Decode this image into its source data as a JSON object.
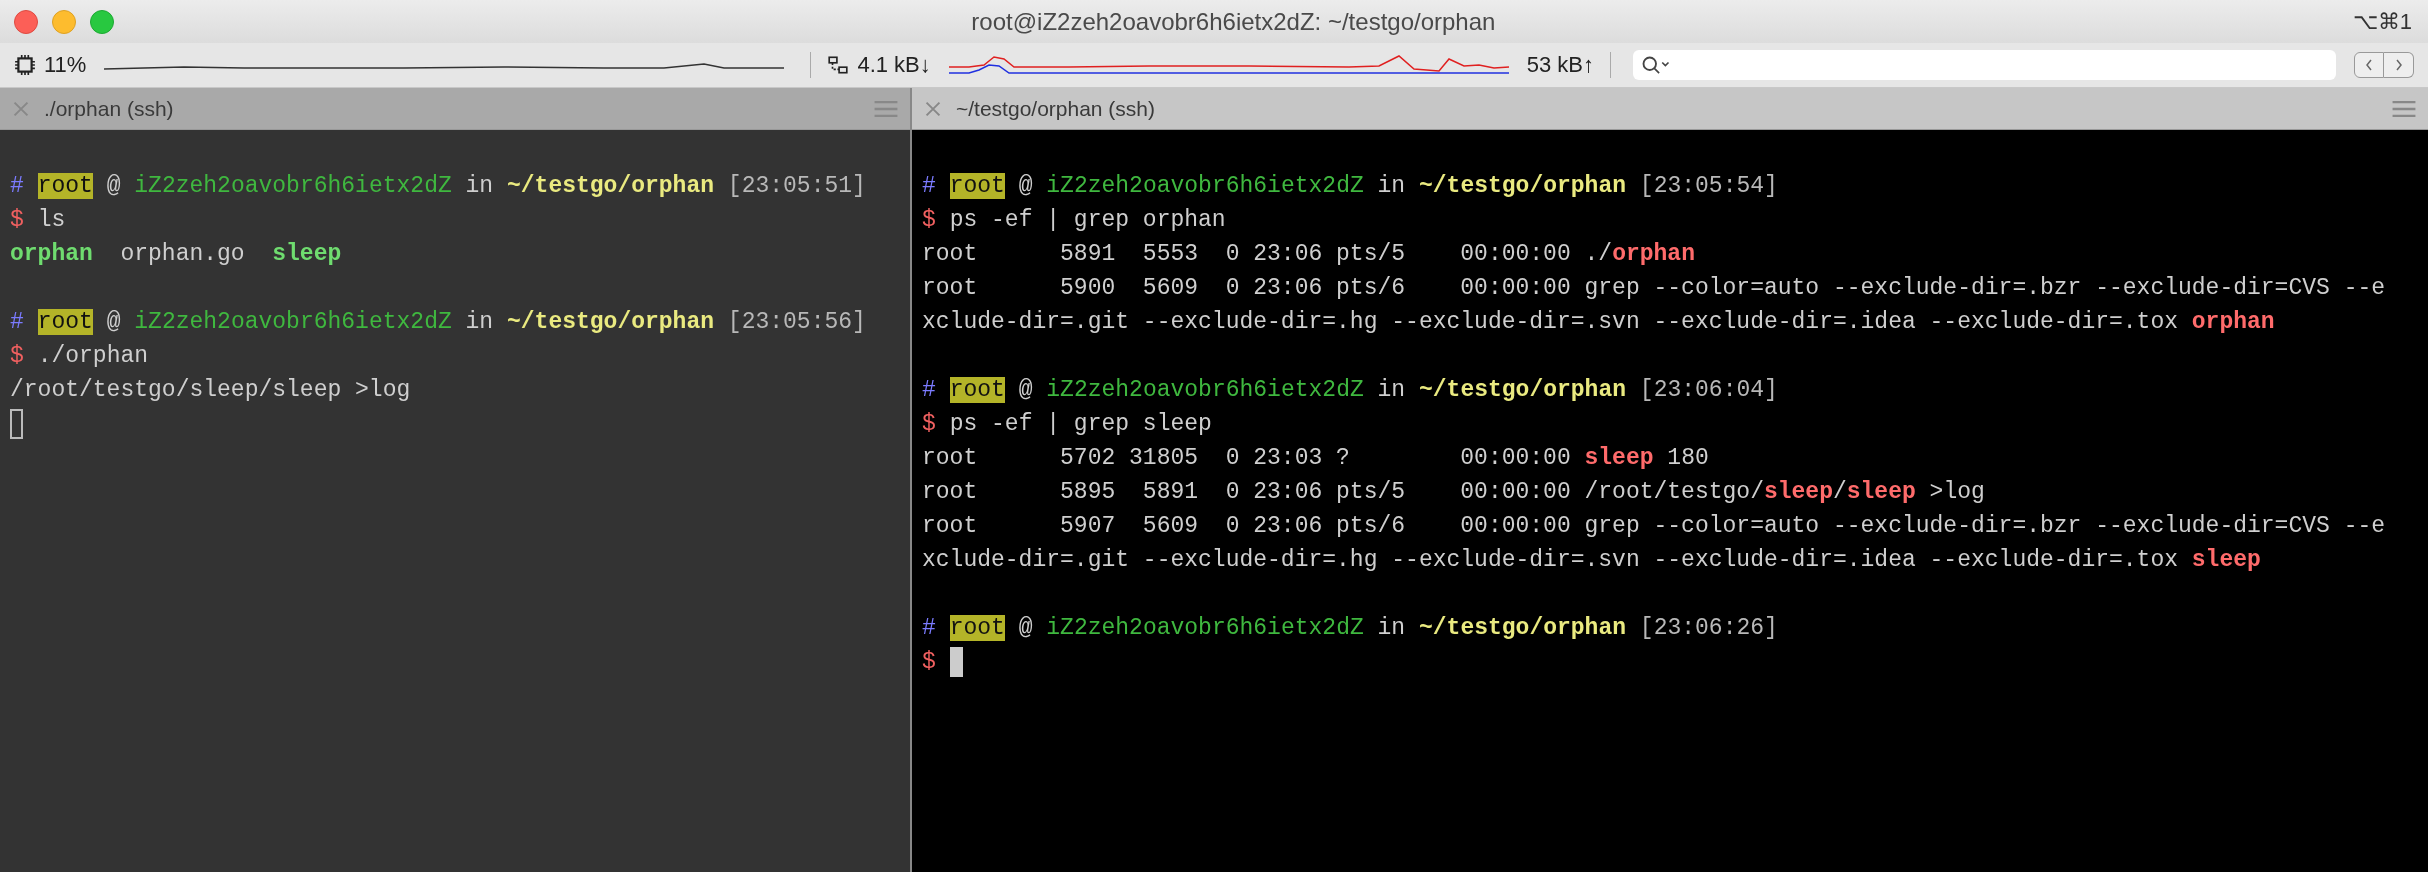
{
  "window": {
    "title": "root@iZ2zeh2oavobr6h6ietx2dZ: ~/testgo/orphan",
    "shortcut": "⌥⌘1"
  },
  "status_bar": {
    "cpu": "11%",
    "download": "4.1 kB↓",
    "upload": "53 kB↑"
  },
  "panes": [
    {
      "tab": "./orphan (ssh)",
      "selected": false,
      "blocks": [
        {
          "lines": [
            {
              "kind": "prompt",
              "hash": "#",
              "user": "root",
              "at": "@",
              "host": "iZ2zeh2oavobr6h6ietx2dZ",
              "in": "in",
              "path": "~/testgo/orphan",
              "time": "[23:05:51]"
            },
            {
              "kind": "command",
              "prompt": "$",
              "command": "ls"
            },
            {
              "kind": "output",
              "segments": [
                {
                  "text": "orphan",
                  "kind": "dir"
                },
                {
                  "text": "  orphan.go  "
                },
                {
                  "text": "sleep",
                  "kind": "dir"
                }
              ]
            }
          ]
        },
        {
          "lines": [
            {
              "kind": "prompt",
              "hash": "#",
              "user": "root",
              "at": "@",
              "host": "iZ2zeh2oavobr6h6ietx2dZ",
              "in": "in",
              "path": "~/testgo/orphan",
              "time": "[23:05:56]"
            },
            {
              "kind": "command",
              "prompt": "$",
              "command": "./orphan"
            },
            {
              "kind": "output",
              "segments": [
                {
                  "text": "/root/testgo/sleep/sleep >log"
                }
              ]
            },
            {
              "kind": "output",
              "cursor": true
            }
          ]
        }
      ]
    },
    {
      "tab": "~/testgo/orphan (ssh)",
      "selected": true,
      "blocks": [
        {
          "lines": [
            {
              "kind": "prompt",
              "hash": "#",
              "user": "root",
              "at": "@",
              "host": "iZ2zeh2oavobr6h6ietx2dZ",
              "in": "in",
              "path": "~/testgo/orphan",
              "time": "[23:05:54]"
            },
            {
              "kind": "command",
              "prompt": "$",
              "command": "ps -ef | grep orphan"
            },
            {
              "kind": "output",
              "segments": [
                {
                  "text": "root      5891  5553  0 23:06 pts/5    00:00:00 ./"
                },
                {
                  "text": "orphan",
                  "kind": "match"
                }
              ]
            },
            {
              "kind": "output",
              "segments": [
                {
                  "text": "root      5900  5609  0 23:06 pts/6    00:00:00 grep --color=auto --exclude-dir=.bzr --exclude-dir=CVS --e"
                }
              ]
            },
            {
              "kind": "output",
              "segments": [
                {
                  "text": "xclude-dir=.git --exclude-dir=.hg --exclude-dir=.svn --exclude-dir=.idea --exclude-dir=.tox "
                },
                {
                  "text": "orphan",
                  "kind": "match"
                }
              ]
            }
          ]
        },
        {
          "lines": [
            {
              "kind": "prompt",
              "hash": "#",
              "user": "root",
              "at": "@",
              "host": "iZ2zeh2oavobr6h6ietx2dZ",
              "in": "in",
              "path": "~/testgo/orphan",
              "time": "[23:06:04]"
            },
            {
              "kind": "command",
              "prompt": "$",
              "command": "ps -ef | grep sleep"
            },
            {
              "kind": "output",
              "segments": [
                {
                  "text": "root      5702 31805  0 23:03 ?        00:00:00 "
                },
                {
                  "text": "sleep",
                  "kind": "match"
                },
                {
                  "text": " 180"
                }
              ]
            },
            {
              "kind": "output",
              "segments": [
                {
                  "text": "root      5895  5891  0 23:06 pts/5    00:00:00 /root/testgo/"
                },
                {
                  "text": "sleep",
                  "kind": "match"
                },
                {
                  "text": "/"
                },
                {
                  "text": "sleep",
                  "kind": "match"
                },
                {
                  "text": " >log"
                }
              ]
            },
            {
              "kind": "output",
              "segments": [
                {
                  "text": "root      5907  5609  0 23:06 pts/6    00:00:00 grep --color=auto --exclude-dir=.bzr --exclude-dir=CVS --e"
                }
              ]
            },
            {
              "kind": "output",
              "segments": [
                {
                  "text": "xclude-dir=.git --exclude-dir=.hg --exclude-dir=.svn --exclude-dir=.idea --exclude-dir=.tox "
                },
                {
                  "text": "sleep",
                  "kind": "match"
                }
              ]
            }
          ]
        },
        {
          "lines": [
            {
              "kind": "prompt",
              "hash": "#",
              "user": "root",
              "at": "@",
              "host": "iZ2zeh2oavobr6h6ietx2dZ",
              "in": "in",
              "path": "~/testgo/orphan",
              "time": "[23:06:26]"
            },
            {
              "kind": "command",
              "prompt": "$",
              "cursor": true
            }
          ]
        }
      ]
    }
  ]
}
